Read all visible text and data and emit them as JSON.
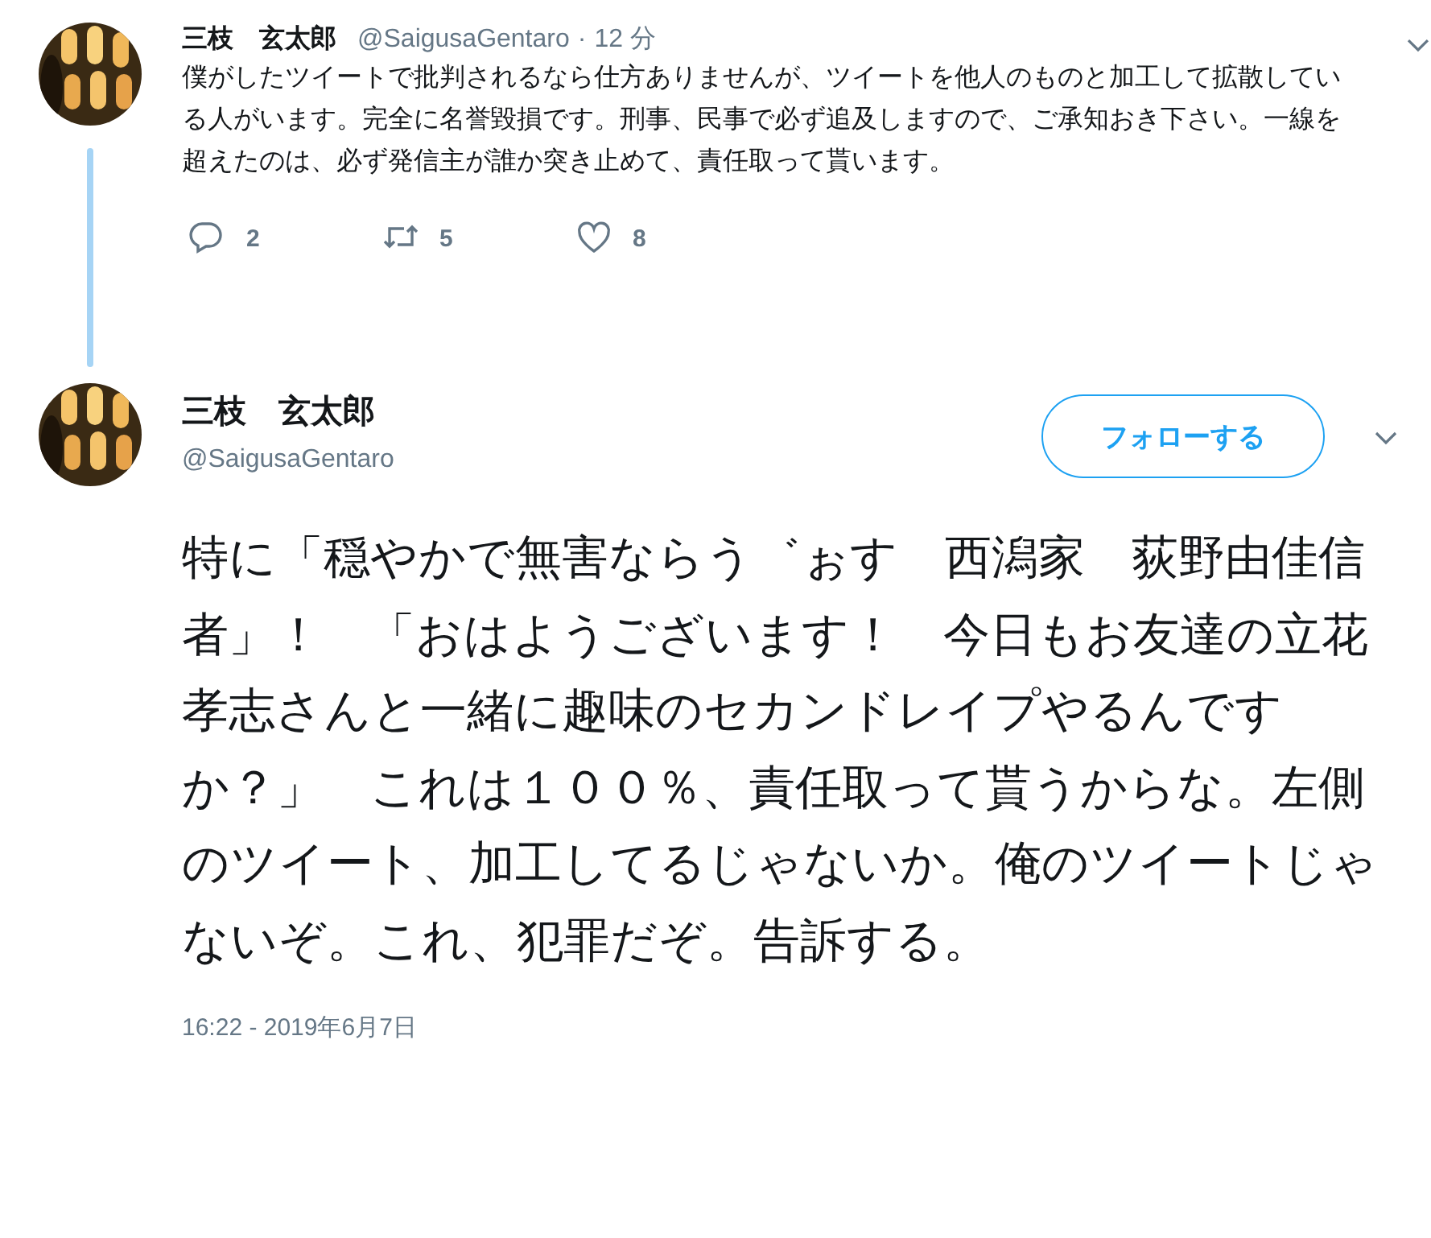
{
  "reply_tweet": {
    "display_name": "三枝　玄太郎",
    "handle": "@SaigusaGentaro",
    "separator": "·",
    "time": "12 分",
    "text": "僕がしたツイートで批判されるなら仕方ありませんが、ツイートを他人のものと加工して拡散している人がいます。完全に名誉毀損です。刑事、民事で必ず追及しますので、ご承知おき下さい。一線を超えたのは、必ず発信主が誰か突き止めて、責任取って貰います。",
    "actions": [
      {
        "kind": "reply",
        "count": "2"
      },
      {
        "kind": "retweet",
        "count": "5"
      },
      {
        "kind": "like",
        "count": "8"
      }
    ]
  },
  "main_tweet": {
    "display_name": "三枝　玄太郎",
    "handle": "@SaigusaGentaro",
    "follow_button": "フォローする",
    "text": "特に「穏やかで無害ならう゛ぉす　西潟家　荻野由佳信者」！　「おはようございます！　今日もお友達の立花孝志さんと一緒に趣味のセカンドレイプやるんですか？」　これは１００％、責任取って貰うからな。左側のツイート、加工してるじゃないか。俺のツイートじゃないぞ。これ、犯罪だぞ。告訴する。",
    "timestamp": "16:22 - 2019年6月7日"
  }
}
